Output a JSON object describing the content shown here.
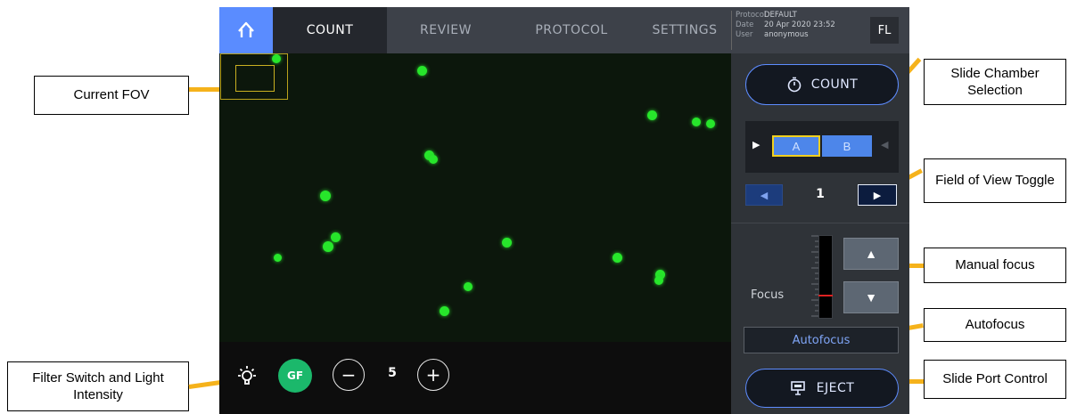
{
  "annotations": {
    "current_fov": "Current FOV",
    "slide_chamber_selection": "Slide Chamber Selection",
    "field_of_view_toggle": "Field of View Toggle",
    "manual_focus": "Manual focus",
    "autofocus": "Autofocus",
    "slide_port_control": "Slide Port Control",
    "filter_switch": "Filter Switch and Light Intensity"
  },
  "nav": {
    "tabs": [
      "COUNT",
      "REVIEW",
      "PROTOCOL",
      "SETTINGS"
    ],
    "active_tab": "COUNT"
  },
  "info": {
    "protocol_label": "Protocol",
    "protocol_value": "DEFAULT",
    "date_label": "Date",
    "date_value": "20 Apr 2020 23:52",
    "user_label": "User",
    "user_value": "anonymous"
  },
  "fl_button": "FL",
  "panel": {
    "count_label": "COUNT",
    "chamber_a": "A",
    "chamber_b": "B",
    "selected_chamber": "A",
    "fov_number": "1",
    "focus_label": "Focus",
    "autofocus_label": "Autofocus",
    "eject_label": "EJECT"
  },
  "bottom": {
    "filter_label": "GF",
    "intensity": "5",
    "minus": "−",
    "plus": "+"
  },
  "colors": {
    "accent_blue": "#5a8cff",
    "filter_green": "#1bb86b",
    "cell_green": "#27e62b",
    "highlight_yellow": "#f0cf1e",
    "leader_orange": "#f5b21b"
  }
}
